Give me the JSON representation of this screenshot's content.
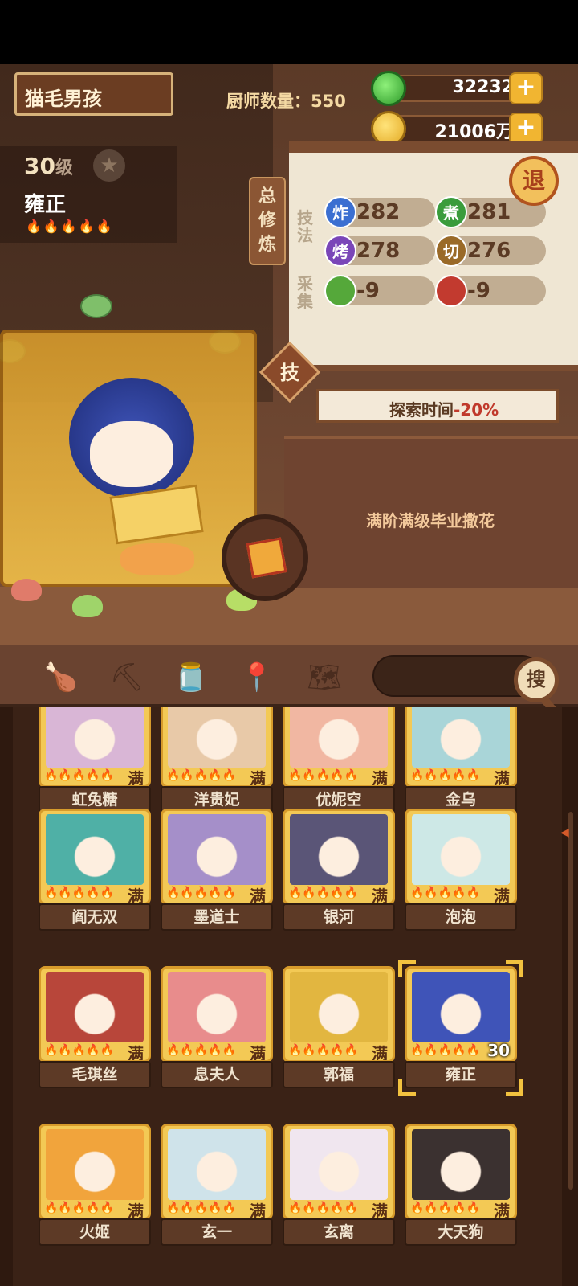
{
  "player": {
    "name": "猫毛男孩"
  },
  "chef_count_label": "厨师数量：550",
  "currency": {
    "jade": "32232",
    "gold": "21006万",
    "plus": "+"
  },
  "hero": {
    "level": "30",
    "level_unit": "级",
    "name": "雍正",
    "flames": "🔥🔥🔥🔥🔥"
  },
  "cultivate_tab": "总修炼",
  "exit_label": "退",
  "skills_section_label": "技法",
  "gather_section_label": "采集",
  "stats": [
    {
      "icon": "炸",
      "value": "282",
      "color": "#3b6fd1"
    },
    {
      "icon": "煮",
      "value": "281",
      "color": "#3a9c3c"
    },
    {
      "icon": "烤",
      "value": "278",
      "color": "#7a46b8"
    },
    {
      "icon": "切",
      "value": "276",
      "color": "#9a6a28"
    },
    {
      "icon": "菜",
      "value": "-9",
      "color": "#55a83a"
    },
    {
      "icon": "肉",
      "value": "-9",
      "color": "#c23a2f"
    }
  ],
  "skill_button": "技",
  "explore_text": {
    "prefix": "探索时间",
    "value": "-20%"
  },
  "description": "满阶满级毕业撒花",
  "search_button": "搜",
  "nav_icons": [
    "meat-icon",
    "shovel-icon",
    "jar-icon",
    "location-icon",
    "map-icon"
  ],
  "cards": [
    {
      "name": "虹兔糖",
      "badge": "满",
      "color": "#d9b6d6"
    },
    {
      "name": "洋贵妃",
      "badge": "满",
      "color": "#e8c9a8"
    },
    {
      "name": "优妮空",
      "badge": "满",
      "color": "#f1b7a2"
    },
    {
      "name": "金乌",
      "badge": "满",
      "color": "#a9d5d8"
    },
    {
      "name": "阎无双",
      "badge": "满",
      "color": "#4fb0a6"
    },
    {
      "name": "墨道士",
      "badge": "满",
      "color": "#a58fc9"
    },
    {
      "name": "银河",
      "badge": "满",
      "color": "#5a5577"
    },
    {
      "name": "泡泡",
      "badge": "满",
      "color": "#cde8e6"
    },
    {
      "name": "毛琪丝",
      "badge": "满",
      "color": "#b8463a"
    },
    {
      "name": "息夫人",
      "badge": "满",
      "color": "#e88c8c"
    },
    {
      "name": "郭福",
      "badge": "满",
      "color": "#e2b640"
    },
    {
      "name": "雍正",
      "badge": "30",
      "color": "#3f54b8"
    },
    {
      "name": "火姬",
      "badge": "满",
      "color": "#f1a43c"
    },
    {
      "name": "玄一",
      "badge": "满",
      "color": "#cfe3ea"
    },
    {
      "name": "玄离",
      "badge": "满",
      "color": "#f0e6ef"
    },
    {
      "name": "大天狗",
      "badge": "满",
      "color": "#3b3130"
    }
  ],
  "card_flames": "🔥🔥🔥🔥🔥"
}
